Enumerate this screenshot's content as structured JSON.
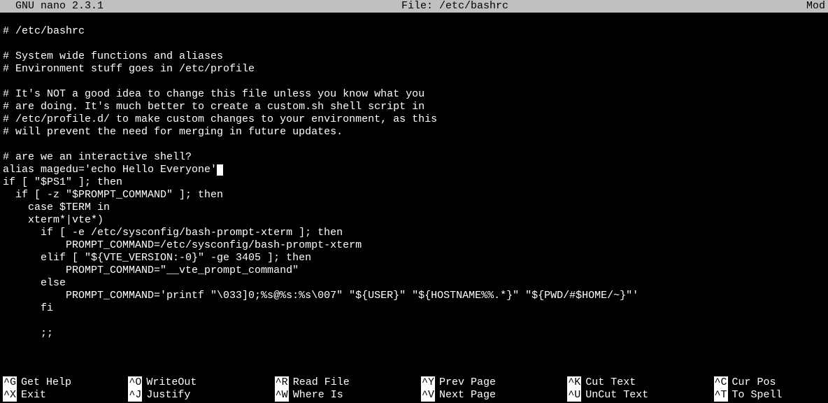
{
  "titlebar": {
    "app": "  GNU nano 2.3.1",
    "file_label": "File: /etc/bashrc",
    "status": "Mod"
  },
  "editor": {
    "lines": [
      "",
      "# /etc/bashrc",
      "",
      "# System wide functions and aliases",
      "# Environment stuff goes in /etc/profile",
      "",
      "# It's NOT a good idea to change this file unless you know what you",
      "# are doing. It's much better to create a custom.sh shell script in",
      "# /etc/profile.d/ to make custom changes to your environment, as this",
      "# will prevent the need for merging in future updates.",
      "",
      "# are we an interactive shell?",
      "alias magedu='echo Hello Everyone'",
      "if [ \"$PS1\" ]; then",
      "  if [ -z \"$PROMPT_COMMAND\" ]; then",
      "    case $TERM in",
      "    xterm*|vte*)",
      "      if [ -e /etc/sysconfig/bash-prompt-xterm ]; then",
      "          PROMPT_COMMAND=/etc/sysconfig/bash-prompt-xterm",
      "      elif [ \"${VTE_VERSION:-0}\" -ge 3405 ]; then",
      "          PROMPT_COMMAND=\"__vte_prompt_command\"",
      "      else",
      "          PROMPT_COMMAND='printf \"\\033]0;%s@%s:%s\\007\" \"${USER}\" \"${HOSTNAME%%.*}\" \"${PWD/#$HOME/~}\"'",
      "      fi",
      "",
      "      ;;"
    ],
    "cursor_line": 12
  },
  "shortcuts": {
    "row1": [
      {
        "key": "^G",
        "label": "Get Help"
      },
      {
        "key": "^O",
        "label": "WriteOut"
      },
      {
        "key": "^R",
        "label": "Read File"
      },
      {
        "key": "^Y",
        "label": "Prev Page"
      },
      {
        "key": "^K",
        "label": "Cut Text"
      },
      {
        "key": "^C",
        "label": "Cur Pos"
      }
    ],
    "row2": [
      {
        "key": "^X",
        "label": "Exit"
      },
      {
        "key": "^J",
        "label": "Justify"
      },
      {
        "key": "^W",
        "label": "Where Is"
      },
      {
        "key": "^V",
        "label": "Next Page"
      },
      {
        "key": "^U",
        "label": "UnCut Text"
      },
      {
        "key": "^T",
        "label": "To Spell"
      }
    ]
  }
}
